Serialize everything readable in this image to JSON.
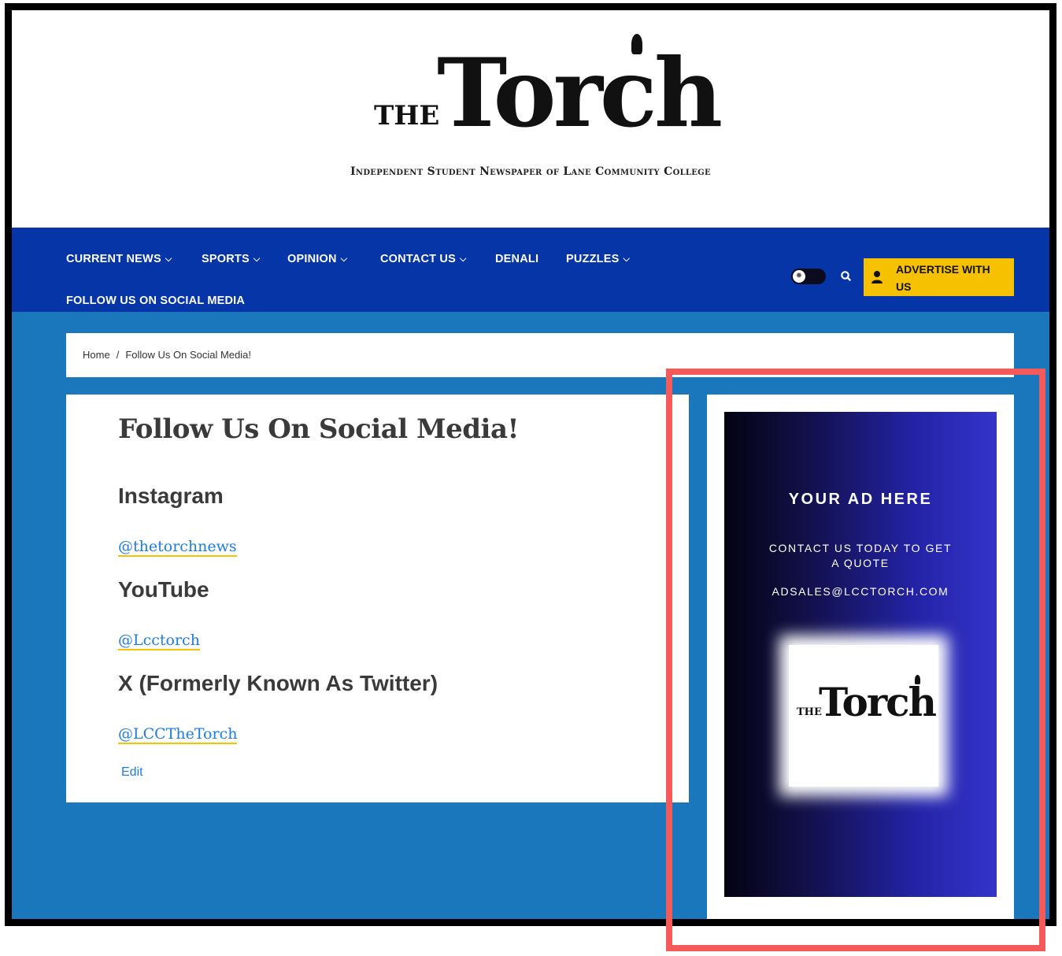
{
  "masthead": {
    "logo_the": "THE",
    "logo_torch": "Torch",
    "tagline": "Independent Student Newspaper of Lane Community College"
  },
  "nav": {
    "items": [
      {
        "label": "CURRENT NEWS",
        "dropdown": true
      },
      {
        "label": "SPORTS",
        "dropdown": true
      },
      {
        "label": "OPINION",
        "dropdown": true
      },
      {
        "label": "CONTACT US",
        "dropdown": true
      },
      {
        "label": "DENALI",
        "dropdown": false
      },
      {
        "label": "PUZZLES",
        "dropdown": true
      }
    ],
    "active_item": "FOLLOW US ON SOCIAL MEDIA",
    "advertise_label": "ADVERTISE WITH US",
    "theme_toggle_icon": "sun-icon",
    "search_icon": "search-icon",
    "user_icon": "user-icon"
  },
  "breadcrumb": {
    "home": "Home",
    "separator": "/",
    "current": "Follow Us On Social Media!"
  },
  "content": {
    "title": "Follow Us On Social Media!",
    "sections": [
      {
        "heading": "Instagram",
        "link": "@thetorchnews"
      },
      {
        "heading": "YouTube",
        "link": "@Lcctorch"
      },
      {
        "heading": "X (Formerly Known As Twitter)",
        "link": "@LCCTheTorch"
      }
    ],
    "edit_label": "Edit"
  },
  "ad": {
    "title": "YOUR AD HERE",
    "subtitle": "CONTACT US TODAY TO GET A QUOTE",
    "email": "ADSALES@LCCTORCH.COM",
    "logo_the": "THE",
    "logo_torch": "Torch"
  },
  "colors": {
    "nav_bg": "#0535a6",
    "accent_yellow": "#f6c200",
    "content_bg": "#1b77bb",
    "link": "#1e7de0",
    "highlight": "#f45a5a"
  }
}
